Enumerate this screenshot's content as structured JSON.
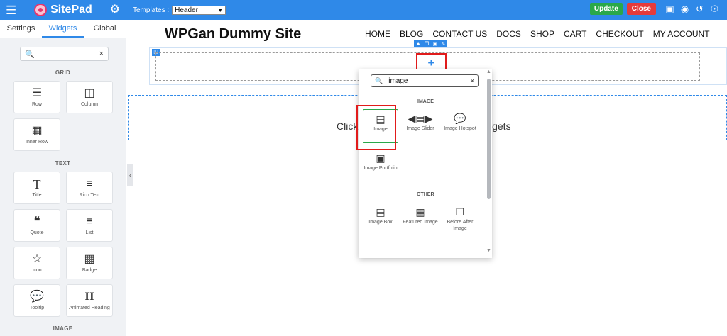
{
  "sidebar": {
    "brand": "SitePad",
    "tabs": [
      "Settings",
      "Widgets",
      "Global"
    ],
    "search_placeholder": "",
    "sections": [
      {
        "label": "GRID",
        "items": [
          "Row",
          "Column",
          "Inner Row"
        ]
      },
      {
        "label": "TEXT",
        "items": [
          "Title",
          "Rich Text",
          "Quote",
          "List",
          "Icon",
          "Badge",
          "Tooltip",
          "Animated Heading"
        ]
      },
      {
        "label": "IMAGE"
      }
    ]
  },
  "topbar": {
    "templates_label": "Templates :",
    "templates_value": "Header",
    "update_label": "Update",
    "close_label": "Close",
    "icons": [
      "desktop-icon",
      "eye-icon",
      "history-icon",
      "sitemap-icon"
    ]
  },
  "site": {
    "title": "WPGan Dummy Site",
    "nav": [
      "HOME",
      "BLOG",
      "CONTACT US",
      "DOCS",
      "SHOP",
      "CART",
      "CHECKOUT",
      "MY ACCOUNT"
    ],
    "click_text_left": "Click",
    "click_text_right": "lgets"
  },
  "popup": {
    "search_value": "image",
    "section_image": "IMAGE",
    "section_other": "OTHER",
    "image_items": [
      "Image",
      "Image Slider",
      "Image Hotspot",
      "Image Portfolio"
    ],
    "other_items": [
      "Image Box",
      "Featured Image",
      "Before After Image"
    ]
  },
  "colors": {
    "accent": "#2f89e8",
    "update": "#2aa84a",
    "close": "#e53b3b",
    "highlight": "#e11b1b"
  }
}
